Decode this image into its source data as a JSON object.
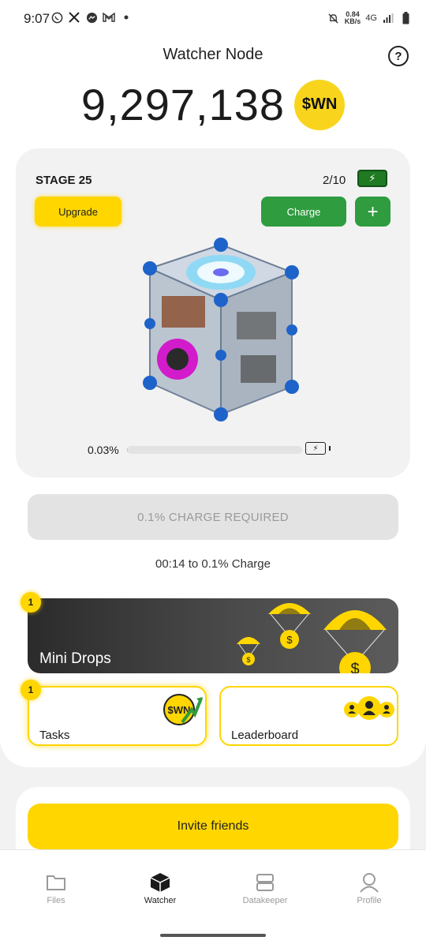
{
  "statusbar": {
    "time": "9:07",
    "net_speed_value": "0.84",
    "net_speed_unit": "KB/s",
    "network": "4G"
  },
  "header": {
    "title": "Watcher Node",
    "help_label": "?"
  },
  "balance": {
    "amount": "9,297,138",
    "coin_label": "$WN"
  },
  "node": {
    "stage_label": "STAGE 25",
    "charges": "2/10",
    "upgrade_label": "Upgrade",
    "charge_label": "Charge",
    "plus_label": "+",
    "progress_text": "0.03%",
    "progress_fraction": 0.0003
  },
  "charge_required": {
    "label": "0.1% CHARGE REQUIRED",
    "timer": "00:14 to 0.1% Charge"
  },
  "mini_drops": {
    "label": "Mini Drops",
    "badge": "1"
  },
  "tasks": {
    "label": "Tasks",
    "badge": "1",
    "coin_label": "$WN"
  },
  "leaderboard": {
    "label": "Leaderboard"
  },
  "invite": {
    "label": "Invite friends"
  },
  "nav": {
    "items": [
      {
        "label": "Files",
        "icon": "folder-icon"
      },
      {
        "label": "Watcher",
        "icon": "cube-icon"
      },
      {
        "label": "Datakeeper",
        "icon": "server-icon"
      },
      {
        "label": "Profile",
        "icon": "profile-icon"
      }
    ],
    "active": "Watcher"
  },
  "colors": {
    "accent_yellow": "#ffd600",
    "charge_green": "#2f9c3f",
    "dark_card": "#3a3a3a"
  }
}
